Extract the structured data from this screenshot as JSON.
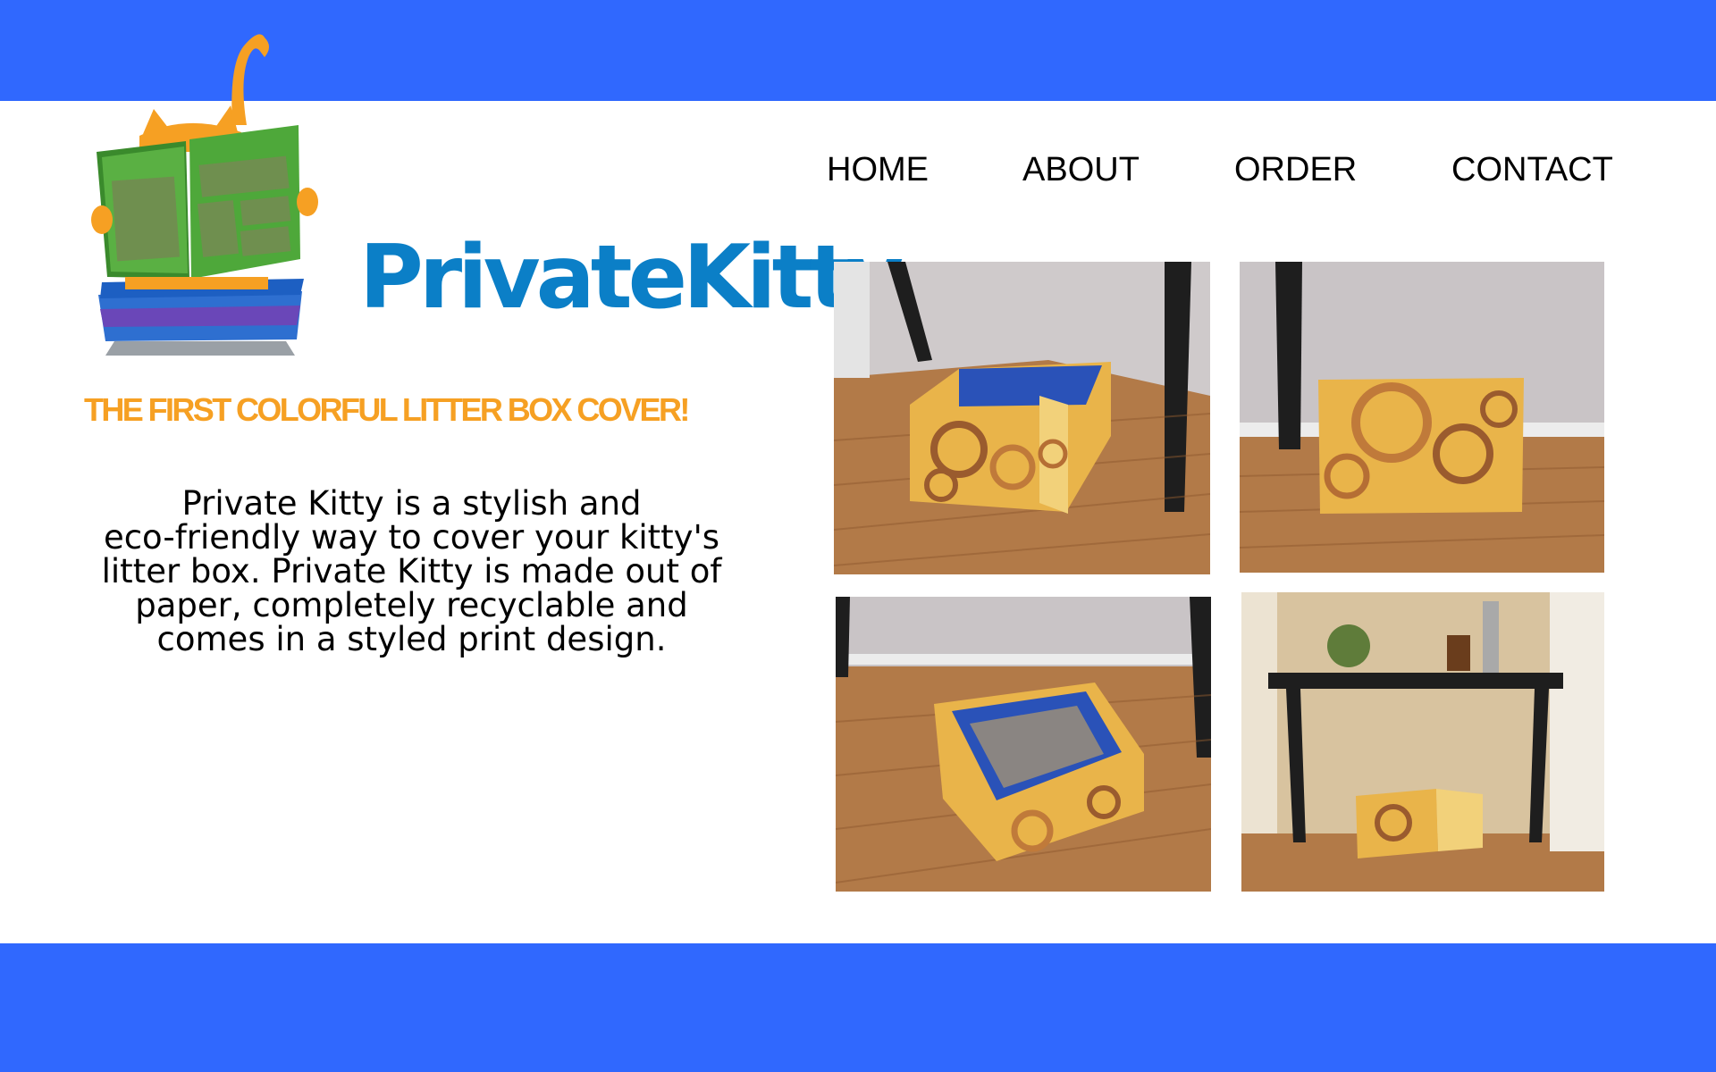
{
  "header": {
    "brand_name": "PrivateKitty",
    "logo_icon": "cat-reading-newspaper-in-litter-box-logo"
  },
  "nav": {
    "items": [
      {
        "label": "HOME"
      },
      {
        "label": "ABOUT"
      },
      {
        "label": "ORDER"
      },
      {
        "label": "CONTACT"
      }
    ]
  },
  "hero": {
    "tagline": "THE FIRST COLORFUL LITTER BOX COVER!",
    "description_lines": [
      "Private Kitty is a stylish and",
      "eco-friendly way to cover your kitty's",
      "litter box. Private Kitty is made out of",
      "paper, completely recyclable and",
      "comes in a styled print design."
    ]
  },
  "gallery": {
    "photos": [
      {
        "icon": "litter-box-cover-front-corner-photo"
      },
      {
        "icon": "litter-box-cover-front-photo"
      },
      {
        "icon": "litter-box-cover-top-view-photo"
      },
      {
        "icon": "litter-box-cover-under-table-photo"
      }
    ]
  },
  "colors": {
    "band": "#3068fe",
    "brand": "#0b7fc7",
    "tagline": "#f6a023",
    "text": "#000000"
  }
}
